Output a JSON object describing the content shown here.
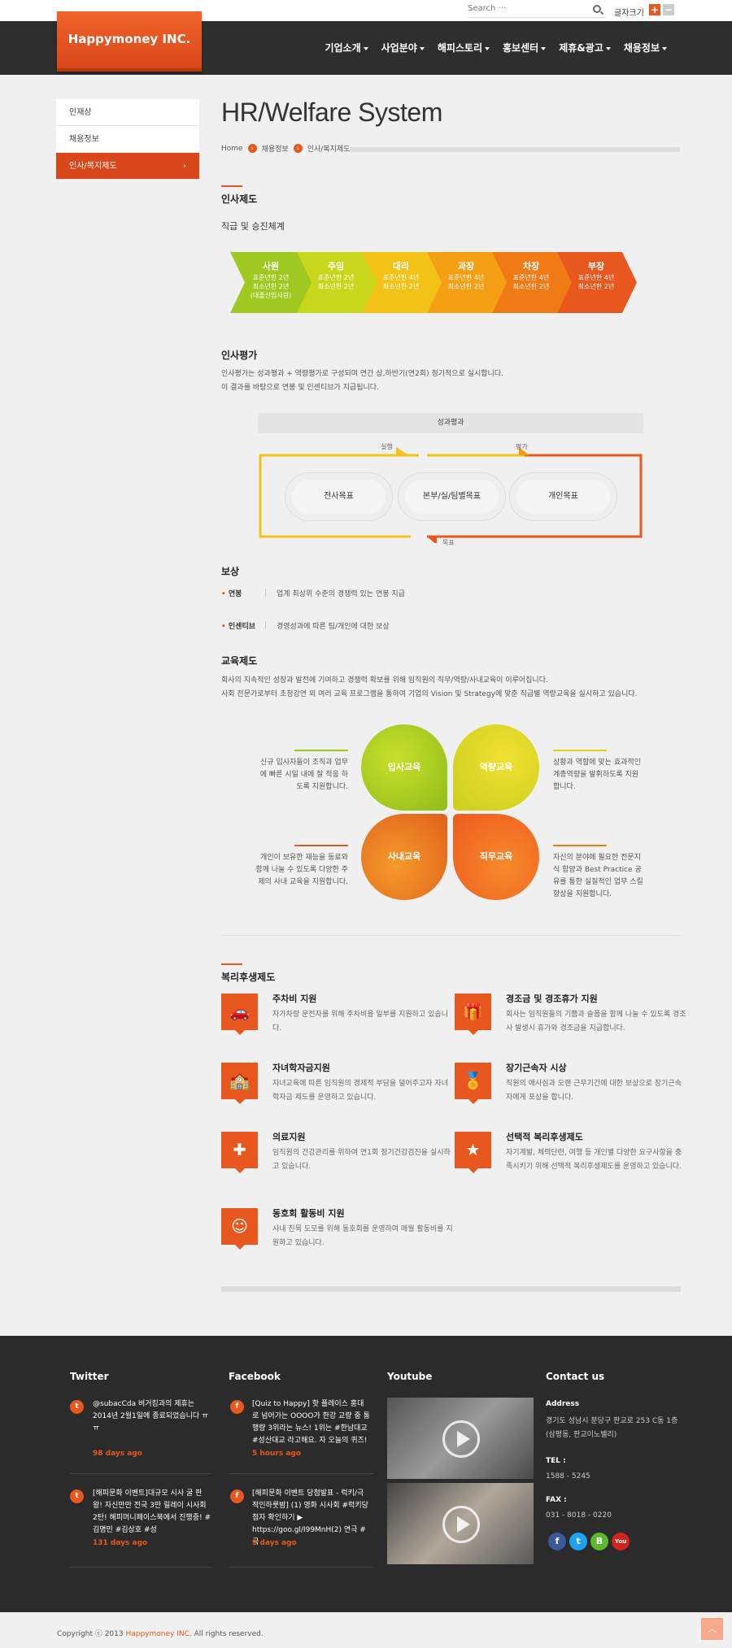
{
  "topbar": {
    "search_placeholder": "Search ···",
    "font_size_label": "글자크기",
    "font_plus": "+",
    "font_minus": "−"
  },
  "header": {
    "logo": "Happymoney INC.",
    "nav": [
      "기업소개",
      "사업분야",
      "해피스토리",
      "홍보센터",
      "제휴&광고",
      "채용정보"
    ]
  },
  "sidebar": {
    "items": [
      {
        "label": "인재상"
      },
      {
        "label": "채용정보"
      },
      {
        "label": "인사/복지제도",
        "arrow": "›"
      }
    ]
  },
  "page": {
    "title": "HR/Welfare System",
    "breadcrumb": [
      "Home",
      "채용정보",
      "인사/복지제도"
    ]
  },
  "hr_system": {
    "title": "인사제도",
    "subtitle": "직급 및 승진체계",
    "ranks": [
      {
        "rank": "사원",
        "lines": [
          "표준년한 2년",
          "최소년한 2년",
          "(대졸신입사원)"
        ],
        "color": "#9fc920"
      },
      {
        "rank": "주임",
        "lines": [
          "표준년한 2년",
          "최소년한 2년"
        ],
        "color": "#c8d71c"
      },
      {
        "rank": "대리",
        "lines": [
          "표준년한 4년",
          "최소년한 2년"
        ],
        "color": "#f2c316"
      },
      {
        "rank": "과장",
        "lines": [
          "표준년한 4년",
          "최소년한 2년"
        ],
        "color": "#f5a014"
      },
      {
        "rank": "차장",
        "lines": [
          "표준년한 4년",
          "최소년한 2년"
        ],
        "color": "#f07b16"
      },
      {
        "rank": "부장",
        "lines": [
          "표준년한 4년",
          "최소년한 2년"
        ],
        "color": "#e8581e"
      }
    ]
  },
  "evaluation": {
    "title": "인사평가",
    "desc": [
      "인사평가는 성과평과 + 역량평가로 구성되며 연간 상,하반기(연2회) 정기적으로 실시합니다.",
      "이 결과를 바탕으로 연봉 및 인센티브가 지급됩니다."
    ],
    "diagram_head": "성과평과",
    "label_exec": "실행",
    "label_eval": "평가",
    "label_goal": "목표",
    "pills": [
      "전사목표",
      "본부/실/팀별목표",
      "개인목표"
    ]
  },
  "compensation": {
    "title": "보상",
    "items": [
      {
        "key": "연봉",
        "value": "업계 최상위 수준의 경쟁력 있는 연봉 지급"
      },
      {
        "key": "인센티브",
        "value": "경영성과에 따른 팀/개인에 대한 보상"
      }
    ]
  },
  "education": {
    "title": "교육제도",
    "desc": [
      "회사의 지속적인 성장과 발전에 기여하고 경쟁력 확보를 위해 임직원의 직무/역량/사내교육이 이루어집니다.",
      "사회 전문가로부터 초청강연 외 여러 교육 프로그램을 통하여 기업의 Vision 및 Strategy에 맞춘 직급별 역량교육을 실시하고 있습니다."
    ],
    "petals": [
      "입사교육",
      "역량교육",
      "사내교육",
      "직무교육"
    ],
    "texts": [
      "신규 입사자들이 조직과 업무에 빠른 시일 내에 잘 적응 하도록 지원합니다.",
      "상황과 역할에 맞는 효과적인 계층역량을 발휘하도록 지원 합니다.",
      "개인이 보유한 재능을 동료와 함께 나눌 수 있도록 다양한 주제의 사내 교육을 지원합니다.",
      "자신의 분야에 필요한 전문지식 함양과 Best Practice 공유를 통한 실질적인 업무 스킬 향상을 지원합니다."
    ]
  },
  "welfare": {
    "title": "복리후생제도",
    "items": [
      {
        "icon": "car-icon",
        "glyph": "🚗",
        "title": "주차비 지원",
        "desc": "자가차량 운전자를 위해 주차비용 일부를 지원하고 있습니다."
      },
      {
        "icon": "gift-icon",
        "glyph": "🎁",
        "title": "경조금 및 경조휴가 지원",
        "desc": "회사는 임직원들의 기쁨과 슬픔을 함께 나눌 수 있도록 경조사 발생시 휴가와 경조금을 지급합니다."
      },
      {
        "icon": "school-icon",
        "glyph": "🏫",
        "title": "자녀학자금지원",
        "desc": "자녀교육에 따른 임직원의 경제적 부담을 덜어주고자 자녀학자금 제도를 운영하고 있습니다."
      },
      {
        "icon": "award-icon",
        "glyph": "🏅",
        "title": "장기근속자 시상",
        "desc": "직원의 애사심과 오랜 근무기간에 대한 보상으로 장기근속자에게 포상을 합니다."
      },
      {
        "icon": "medical-kit-icon",
        "glyph": "✚",
        "title": "의료지원",
        "desc": "임직원의 건강관리를 위하여 연1회 정기건강검진을 실시하고 있습니다."
      },
      {
        "icon": "star-icon",
        "glyph": "★",
        "title": "선택적 복리후생제도",
        "desc": "자기계발, 체력단련, 여행 등 개인별 다양한 요구사항을 충족시키기 위해 선택적 복리후생제도를 운영하고 있습니다."
      },
      {
        "icon": "smiley-icon",
        "glyph": "☺",
        "title": "동호회 활동비 지원",
        "desc": "사내 친목 도모를 위해 동호회를 운영하며 매월 활동비를 지원하고 있습니다."
      }
    ]
  },
  "footer": {
    "twitter": {
      "title": "Twitter",
      "posts": [
        {
          "text": "@subacCda 버거킹과의 제휴는 2014년 2월1일에 종료되었습니다 ㅠㅠ",
          "time": "98 days ago"
        },
        {
          "text": "[해피문화 이벤트]대규모 시사 굴 판왕! 자신만만 전국 3만 릴레이 시사회 2탄! 해피머니페이스북에서 진행중! #김명민 #김상호 #성",
          "time": "131 days ago"
        }
      ]
    },
    "facebook": {
      "title": "Facebook",
      "posts": [
        {
          "text": "[Quiz to Happy] 핫 플레이스 홍대로 넘어가는 OOOO가 한강 교량 중 통행량 3위라는 뉴스! 1위는 #한남대교 #성산대교 라고해요. 자 오늘의 퀴즈!",
          "time": "5 hours ago"
        },
        {
          "text": "[해피문화 이벤트 당첨발표 - 럭키/극적인하룻밤] (1) 영화 시사회 #럭키당첨자 확인하기 ▶ https://goo.gl/I99MnH(2) 연극 #극",
          "time": "3 days ago"
        }
      ]
    },
    "youtube": {
      "title": "Youtube"
    },
    "contact": {
      "title": "Contact us",
      "address_label": "Address",
      "address": "경기도 성남시 분당구 판교로 253 C동 1층(삼평동, 판교이노밸리)",
      "tel_label": "TEL :",
      "tel": "1588 - 5245",
      "fax_label": "FAX :",
      "fax": "031 - 8018 - 0220",
      "social": [
        {
          "name": "facebook-icon",
          "glyph": "f",
          "color": "#3b5998"
        },
        {
          "name": "twitter-icon",
          "glyph": "t",
          "color": "#1da1f2"
        },
        {
          "name": "blog-icon",
          "glyph": "B",
          "color": "#5cb82c"
        },
        {
          "name": "youtube-icon",
          "glyph": "You",
          "color": "#d0241c"
        }
      ]
    },
    "copyright_prefix": "Copyright ⓒ 2013 ",
    "copyright_brand": "Happymoney INC.",
    "copyright_suffix": " All rights reserved."
  }
}
